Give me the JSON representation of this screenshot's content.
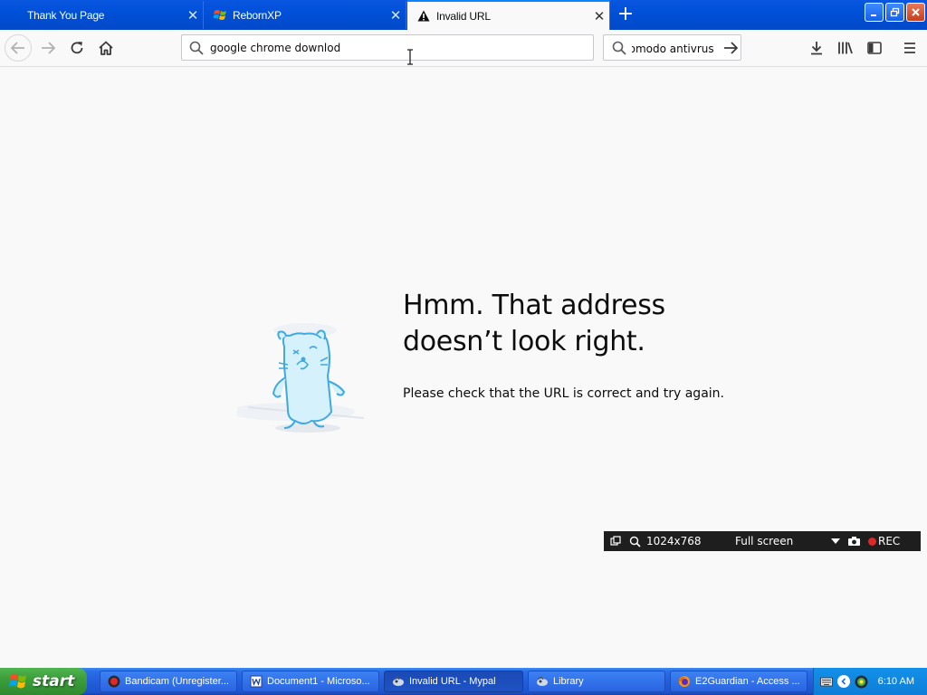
{
  "tabs": [
    {
      "label": "Thank You Page",
      "active": false
    },
    {
      "label": "RebornXP",
      "active": false
    },
    {
      "label": "Invalid URL",
      "active": true
    }
  ],
  "tab_close_glyph": "✕",
  "new_tab_glyph": "+",
  "navbar": {
    "url_value": "google chrome downlod",
    "search_value": "comodo antivrus"
  },
  "error_page": {
    "title_line1": "Hmm. That address",
    "title_line2": "doesn’t look right.",
    "description": "Please check that the URL is correct and try again."
  },
  "recorder": {
    "resolution": "1024x768",
    "mode": "Full screen",
    "rec_label": "REC"
  },
  "taskbar": {
    "start_label": "start",
    "buttons": [
      {
        "label": "Bandicam (Unregister...",
        "icon": "bandicam-icon"
      },
      {
        "label": "Document1 - Microso...",
        "icon": "word-icon"
      },
      {
        "label": "Invalid URL - Mypal",
        "icon": "mypal-icon",
        "active": true
      },
      {
        "label": "Library",
        "icon": "library-icon"
      },
      {
        "label": "E2Guardian - Access ...",
        "icon": "firefox-icon"
      }
    ],
    "clock": "6:10 AM"
  },
  "colors": {
    "accent": "#0a84ff",
    "xp_blue": "#245edb",
    "start_green": "#3c9e3c"
  }
}
